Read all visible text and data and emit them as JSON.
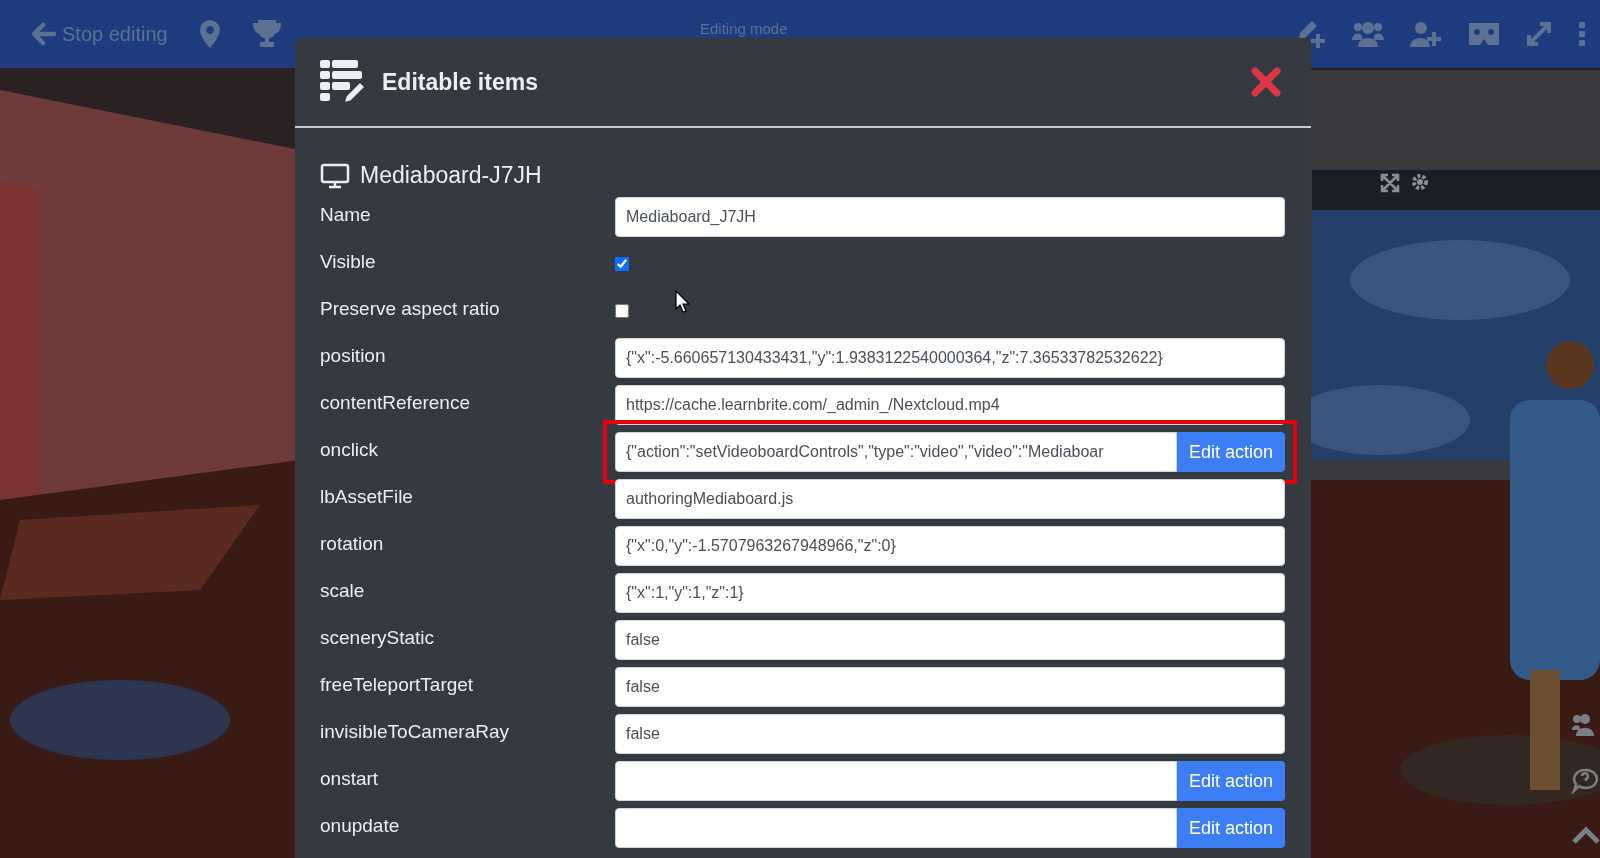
{
  "topbar": {
    "back_label": "Stop editing",
    "title": "Editing mode"
  },
  "modal": {
    "title": "Editable items",
    "item_title": "Mediaboard-J7JH",
    "fields": [
      {
        "kind": "text",
        "label": "Name",
        "value": "Mediaboard_J7JH"
      },
      {
        "kind": "checkbox",
        "label": "Visible",
        "checked": true
      },
      {
        "kind": "checkbox",
        "label": "Preserve aspect ratio",
        "checked": false
      },
      {
        "kind": "text",
        "label": "position",
        "value": "{\"x\":-5.660657130433431,\"y\":1.9383122540000364,\"z\":7.36533782532622}"
      },
      {
        "kind": "text",
        "label": "contentReference",
        "value": "https://cache.learnbrite.com/_admin_/Nextcloud.mp4"
      },
      {
        "kind": "action",
        "label": "onclick",
        "value": "{\"action\":\"setVideoboardControls\",\"type\":\"video\",\"video\":\"Mediaboar",
        "button": "Edit action",
        "highlighted": true
      },
      {
        "kind": "text",
        "label": "lbAssetFile",
        "value": "authoringMediaboard.js"
      },
      {
        "kind": "text",
        "label": "rotation",
        "value": "{\"x\":0,\"y\":-1.5707963267948966,\"z\":0}"
      },
      {
        "kind": "text",
        "label": "scale",
        "value": "{\"x\":1,\"y\":1,\"z\":1}"
      },
      {
        "kind": "text",
        "label": "sceneryStatic",
        "value": "false"
      },
      {
        "kind": "text",
        "label": "freeTeleportTarget",
        "value": "false"
      },
      {
        "kind": "text",
        "label": "invisibleToCameraRay",
        "value": "false"
      },
      {
        "kind": "action",
        "label": "onstart",
        "button": "Edit action",
        "highlighted": false
      },
      {
        "kind": "action",
        "label": "onupdate",
        "button": "Edit action",
        "highlighted": false
      }
    ]
  }
}
